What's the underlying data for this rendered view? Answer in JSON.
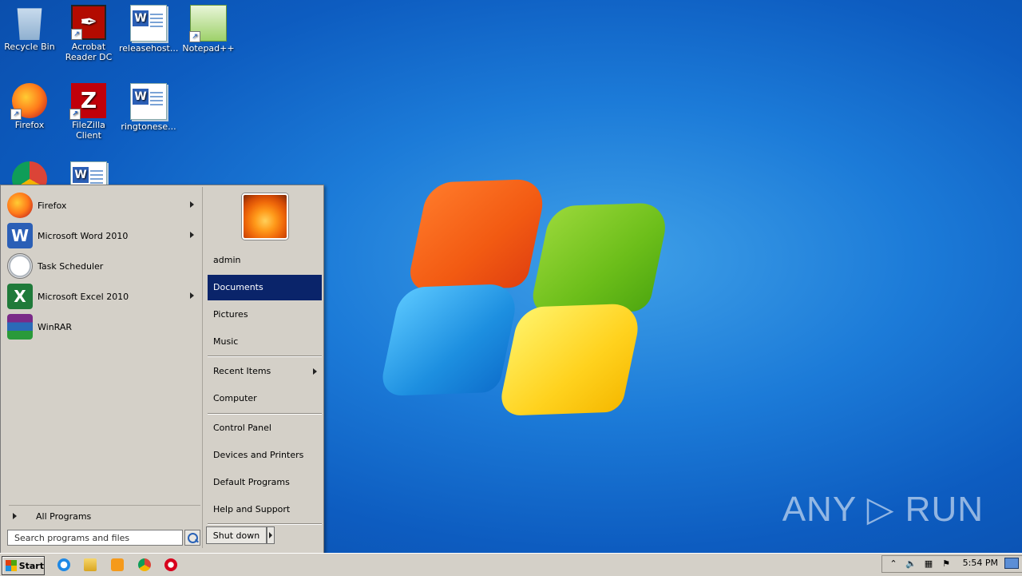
{
  "desktop": {
    "icons": [
      {
        "label": "Recycle Bin"
      },
      {
        "label": "Acrobat Reader DC"
      },
      {
        "label": "releasehost..."
      },
      {
        "label": "Notepad++"
      },
      {
        "label": "Firefox"
      },
      {
        "label": "FileZilla Client"
      },
      {
        "label": "ringtonese..."
      }
    ],
    "watermark": "ANY ▷ RUN"
  },
  "start_menu": {
    "programs": [
      {
        "label": "Firefox",
        "icon": "firefox-icon",
        "has_submenu": true
      },
      {
        "label": "Microsoft Word 2010",
        "icon": "word-icon",
        "has_submenu": true
      },
      {
        "label": "Task Scheduler",
        "icon": "clock-icon",
        "has_submenu": false
      },
      {
        "label": "Microsoft Excel 2010",
        "icon": "excel-icon",
        "has_submenu": true
      },
      {
        "label": "WinRAR",
        "icon": "winrar-icon",
        "has_submenu": false
      }
    ],
    "all_programs": "All Programs",
    "search_placeholder": "Search programs and files",
    "right": {
      "user": "admin",
      "items": [
        "Documents",
        "Pictures",
        "Music",
        "Recent Items",
        "Computer",
        "Control Panel",
        "Devices and Printers",
        "Default Programs",
        "Help and Support"
      ],
      "selected": "Documents"
    },
    "shutdown": "Shut down"
  },
  "taskbar": {
    "start_label": "Start",
    "clock": "5:54 PM"
  }
}
